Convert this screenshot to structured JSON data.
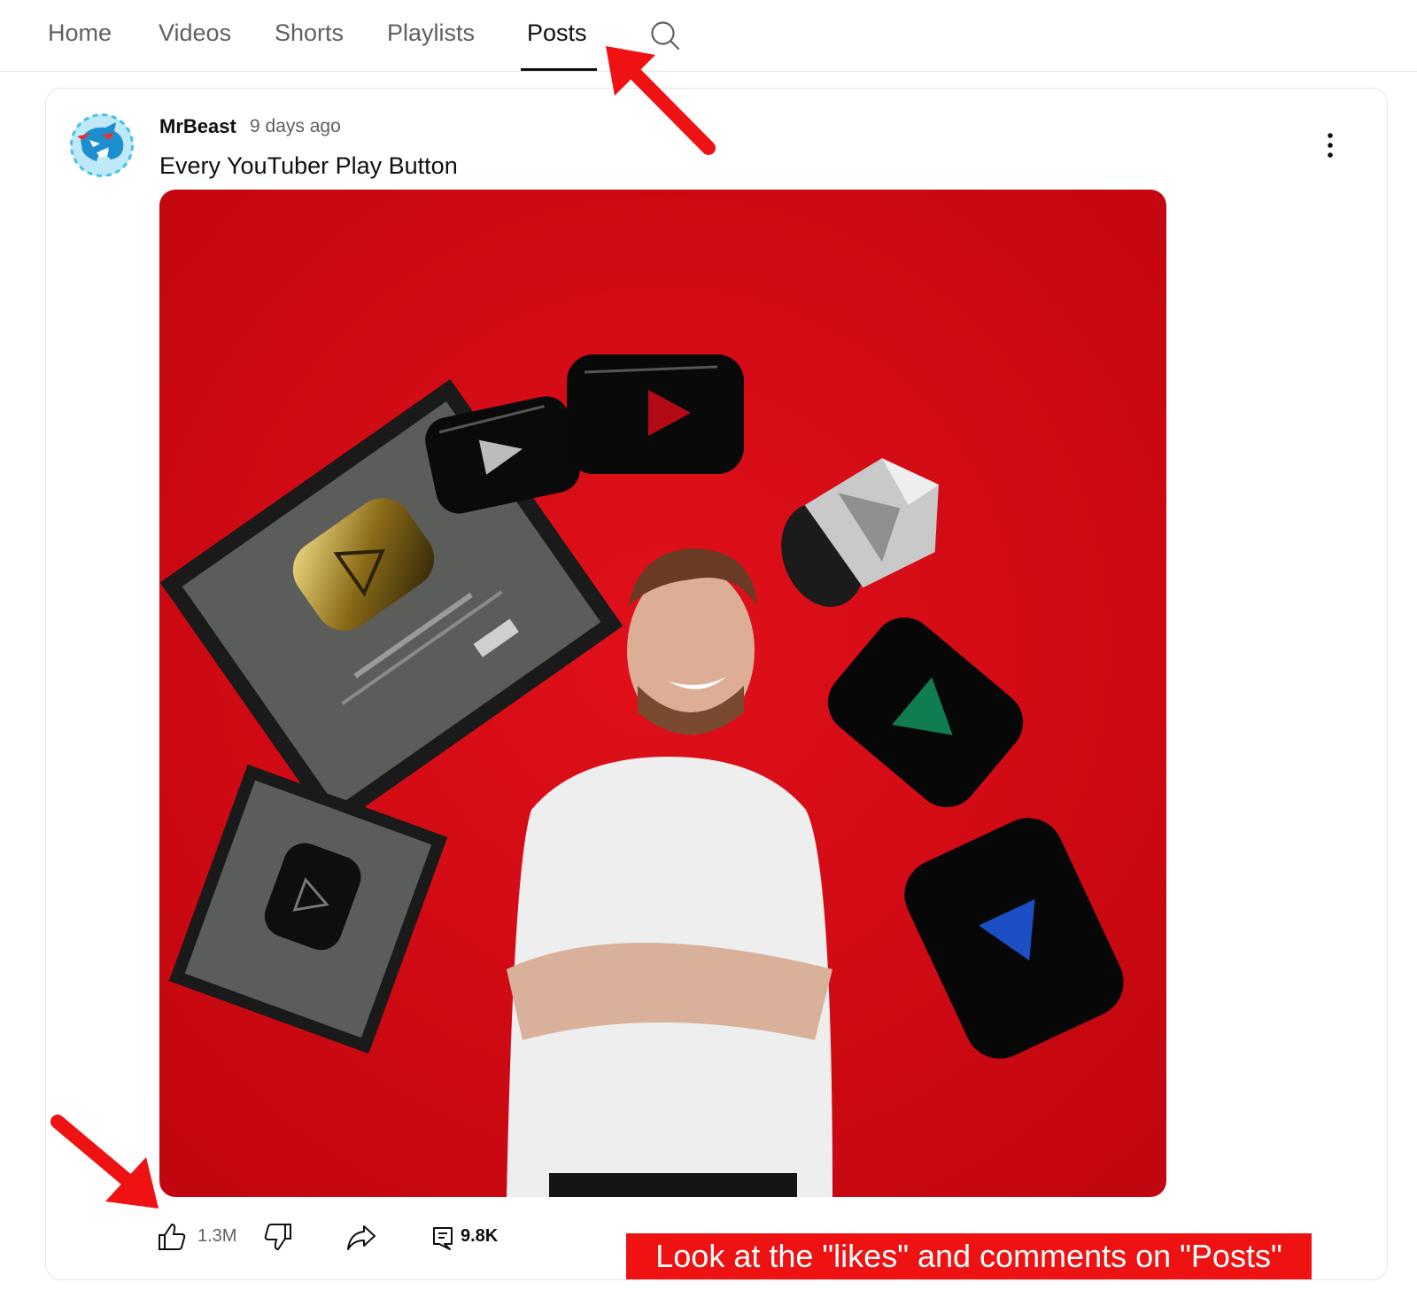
{
  "tabs": [
    {
      "label": "Home",
      "active": false
    },
    {
      "label": "Videos",
      "active": false
    },
    {
      "label": "Shorts",
      "active": false
    },
    {
      "label": "Playlists",
      "active": false
    },
    {
      "label": "Posts",
      "active": true
    }
  ],
  "search": {
    "icon": "search-icon"
  },
  "post": {
    "author": "MrBeast",
    "time": "9 days ago",
    "title": "Every YouTuber Play Button",
    "avatar_icon": "mrbeast-panther-logo",
    "menu_icon": "more-vertical-icon",
    "likes": "1.3M",
    "comments": "9.8K"
  },
  "annotation": {
    "text": "Look at the \"likes\" and comments on \"Posts\"",
    "color": "#ef1212"
  },
  "colors": {
    "active_tab": "#0f0f0f",
    "inactive_tab": "#606060",
    "border": "#e5e5e5",
    "image_background": "#d10a14"
  }
}
